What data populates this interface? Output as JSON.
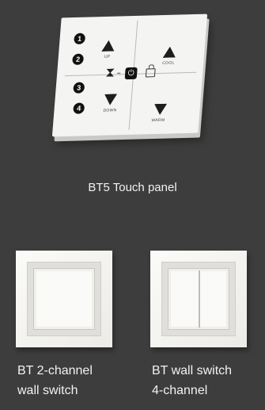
{
  "panel": {
    "caption": "BT5 Touch panel",
    "buttons": [
      {
        "number": "1"
      },
      {
        "number": "2"
      },
      {
        "number": "3"
      },
      {
        "number": "4"
      }
    ],
    "labels": {
      "up": "UP",
      "down": "DOWN",
      "cool": "COOL",
      "warm": "WARM"
    },
    "power_symbol": "⏻"
  },
  "switches": [
    {
      "line1": "BT 2-channel",
      "line2": "wall switch"
    },
    {
      "line1": "BT wall switch",
      "line2": "4-channel"
    }
  ],
  "colors": {
    "background": "#3d3d3d",
    "text": "#f2f2f2"
  }
}
